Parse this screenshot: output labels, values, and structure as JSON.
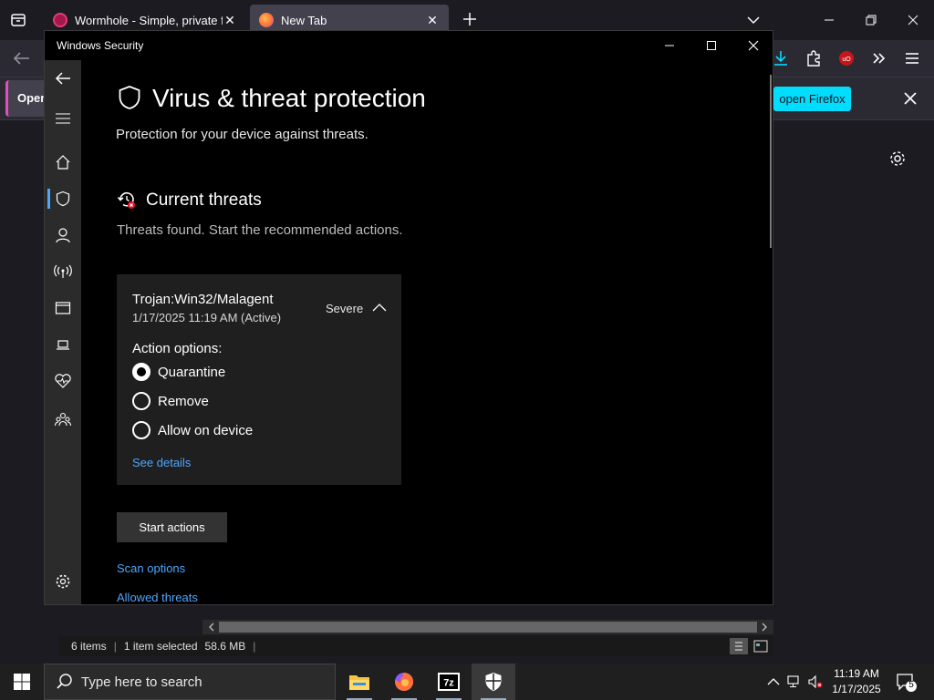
{
  "browser": {
    "tabs": [
      {
        "title": "Wormhole - Simple, private file",
        "favicon_color": "#a3174a"
      },
      {
        "title": "New Tab",
        "favicon_color": "#ff7139"
      }
    ],
    "notification": {
      "left_label": "Open",
      "action_label": "open Firefox",
      "action_color": "#00ddff"
    }
  },
  "explorer": {
    "status": {
      "items": "6 items",
      "selected": "1 item selected",
      "size": "58.6 MB"
    }
  },
  "security_window": {
    "title": "Windows Security",
    "page": {
      "title": "Virus & threat protection",
      "subtitle": "Protection for your device against threats."
    },
    "current_threats": {
      "heading": "Current threats",
      "subtitle": "Threats found. Start the recommended actions."
    },
    "threat": {
      "name": "Trojan:Win32/Malagent",
      "date": "1/17/2025 11:19 AM (Active)",
      "severity": "Severe",
      "action_options_label": "Action options:",
      "options": [
        {
          "label": "Quarantine",
          "selected": true
        },
        {
          "label": "Remove",
          "selected": false
        },
        {
          "label": "Allow on device",
          "selected": false
        }
      ],
      "details_link": "See details"
    },
    "start_actions_label": "Start actions",
    "links": {
      "scan_options": "Scan options",
      "allowed_threats": "Allowed threats"
    },
    "accent": "#4ea6ff"
  },
  "taskbar": {
    "search_placeholder": "Type here to search",
    "clock": {
      "time": "11:19 AM",
      "date": "1/17/2025"
    },
    "notification_count": "5"
  }
}
